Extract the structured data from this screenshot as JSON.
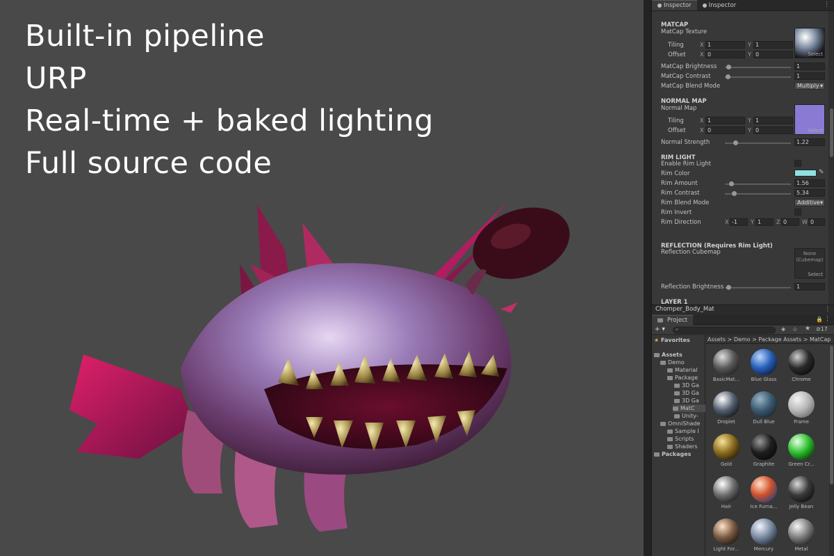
{
  "headline": {
    "lines": [
      "Built-in pipeline",
      "URP",
      "Real-time + baked lighting",
      "Full source code"
    ]
  },
  "inspector": {
    "tabs": [
      "Inspector",
      "Inspector"
    ],
    "matcap": {
      "section": "MATCAP",
      "texture_label": "MatCap Texture",
      "tiling_label": "Tiling",
      "offset_label": "Offset",
      "tiling_x": "1",
      "tiling_y": "1",
      "offset_x": "0",
      "offset_y": "0",
      "select": "Select",
      "brightness_label": "MatCap Brightness",
      "brightness_value": "1",
      "contrast_label": "MatCap Contrast",
      "contrast_value": "1",
      "blend_label": "MatCap Blend Mode",
      "blend_value": "Multiply"
    },
    "normal": {
      "section": "NORMAL MAP",
      "map_label": "Normal Map",
      "tiling_label": "Tiling",
      "offset_label": "Offset",
      "tiling_x": "1",
      "tiling_y": "1",
      "offset_x": "0",
      "offset_y": "0",
      "select": "Select",
      "strength_label": "Normal Strength",
      "strength_value": "1.22"
    },
    "rim": {
      "section": "RIM LIGHT",
      "enable_label": "Enable Rim Light",
      "color_label": "Rim Color",
      "rim_color": "#8fe0e0",
      "amount_label": "Rim Amount",
      "amount_value": "1.56",
      "contrast_label": "Rim Contrast",
      "contrast_value": "5.34",
      "blend_label": "Rim Blend Mode",
      "blend_value": "Additive",
      "invert_label": "Rim Invert",
      "direction_label": "Rim Direction",
      "dir_x": "-1",
      "dir_y": "1",
      "dir_z": "0",
      "dir_w": "0"
    },
    "reflection": {
      "section": "REFLECTION (Requires Rim Light)",
      "cubemap_label": "Reflection Cubemap",
      "none_text": "None (Cubemap)",
      "select": "Select",
      "brightness_label": "Reflection Brightness",
      "brightness_value": "1"
    },
    "layer_label": "LAYER 1",
    "material_name": "Chomper_Body_Mat"
  },
  "project": {
    "tab": "Project",
    "add_label": "+ ▾",
    "hidden_count": "17",
    "tree": {
      "favorites": "Favorites",
      "assets": "Assets",
      "demo": "Demo",
      "materials": "Material",
      "package": "Package",
      "g1": "3D Ga",
      "g2": "3D Ga",
      "g3": "3D Ga",
      "matcap": "MatC",
      "unity": "Unity-",
      "omnishade": "OmniShade",
      "sample": "Sample I",
      "scripts": "Scripts",
      "shaders": "Shaders",
      "packages": "Packages"
    },
    "breadcrumb": [
      "Assets",
      "Demo",
      "Package Assets",
      "MatCap"
    ],
    "items": [
      {
        "label": "BasicMat...",
        "c1": "#e0e0e0",
        "c2": "#5a5a5a",
        "c3": "#1e1e1e"
      },
      {
        "label": "Blue Glass",
        "c1": "#bcd6ff",
        "c2": "#2860b8",
        "c3": "#0a1a40"
      },
      {
        "label": "Chrome",
        "c1": "#cfcfcf",
        "c2": "#2a2a2a",
        "c3": "#0a0a0a"
      },
      {
        "label": "Droplet",
        "c1": "#ffffff",
        "c2": "#556070",
        "c3": "#0d1018"
      },
      {
        "label": "Dull Blue",
        "c1": "#9ab4c8",
        "c2": "#3c5a70",
        "c3": "#16242e"
      },
      {
        "label": "Frame",
        "c1": "#f4f4f4",
        "c2": "#b8b8b8",
        "c3": "#6a6a6a"
      },
      {
        "label": "Gold",
        "c1": "#f8e39a",
        "c2": "#8a6c1e",
        "c3": "#241a04"
      },
      {
        "label": "Graphite",
        "c1": "#9a9a9a",
        "c2": "#1e1e1e",
        "c3": "#080808"
      },
      {
        "label": "Green Cr...",
        "c1": "#e6ffe6",
        "c2": "#2fbf2f",
        "c3": "#063806"
      },
      {
        "label": "Hair",
        "c1": "#ffffff",
        "c2": "#6e6e6e",
        "c3": "#1a1a1a"
      },
      {
        "label": "Ice Furna...",
        "c1": "#ffe0c8",
        "c2": "#d0502a",
        "c3": "#28407a"
      },
      {
        "label": "Jelly Bean",
        "c1": "#d8d8d8",
        "c2": "#3a3a3a",
        "c3": "#0e0e0e"
      },
      {
        "label": "Light For...",
        "c1": "#ffe2c8",
        "c2": "#7a5a44",
        "c3": "#1c140e"
      },
      {
        "label": "Mercury",
        "c1": "#f0f4ff",
        "c2": "#7a8aa0",
        "c3": "#202838"
      },
      {
        "label": "Metal",
        "c1": "#f6f6f6",
        "c2": "#7e7e7e",
        "c3": "#1c1c1c"
      }
    ]
  }
}
